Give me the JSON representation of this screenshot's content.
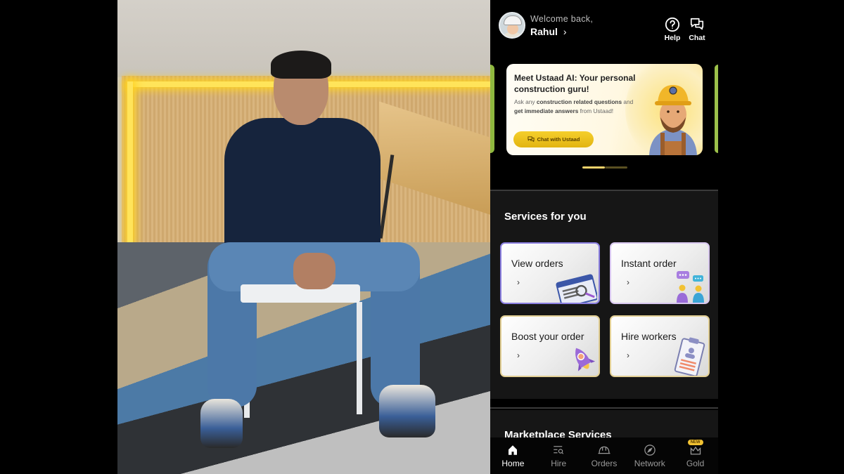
{
  "header": {
    "welcome_text": "Welcome back,",
    "user_name": "Rahul",
    "user_chevron": "›",
    "help_label": "Help",
    "chat_label": "Chat"
  },
  "banner": {
    "title": "Meet Ustaad AI: Your personal construction guru!",
    "desc_parts": {
      "p1": "Ask any ",
      "b1": "construction related questions",
      "p2": " and ",
      "b2": "get immediate answers",
      "p3": " from Ustaad!"
    },
    "cta_label": "Chat with Ustaad",
    "carousel": {
      "active_index": 0,
      "total": 2
    }
  },
  "services": {
    "title": "Services for you",
    "cards": [
      {
        "label": "View orders",
        "chevron": "›",
        "icon": "browser-search-icon"
      },
      {
        "label": "Instant order",
        "chevron": "›",
        "icon": "chat-people-icon"
      },
      {
        "label": "Boost your order",
        "chevron": "›",
        "icon": "rocket-icon"
      },
      {
        "label": "Hire workers",
        "chevron": "›",
        "icon": "clipboard-profile-icon"
      }
    ]
  },
  "marketplace": {
    "title": "Marketplace Services"
  },
  "bottom_nav": {
    "items": [
      {
        "label": "Home",
        "icon": "home-icon",
        "active": true
      },
      {
        "label": "Hire",
        "icon": "search-list-icon",
        "active": false
      },
      {
        "label": "Orders",
        "icon": "hard-hat-icon",
        "active": false
      },
      {
        "label": "Network",
        "icon": "compass-icon",
        "active": false
      },
      {
        "label": "Gold",
        "icon": "crown-icon",
        "active": false,
        "badge": "NEW"
      }
    ]
  },
  "colors": {
    "accent_yellow": "#f5cf2c",
    "background": "#000000",
    "section_bg": "#161616",
    "card_border_view": "#8b7fe0",
    "card_border_gold": "#e2cf94"
  }
}
